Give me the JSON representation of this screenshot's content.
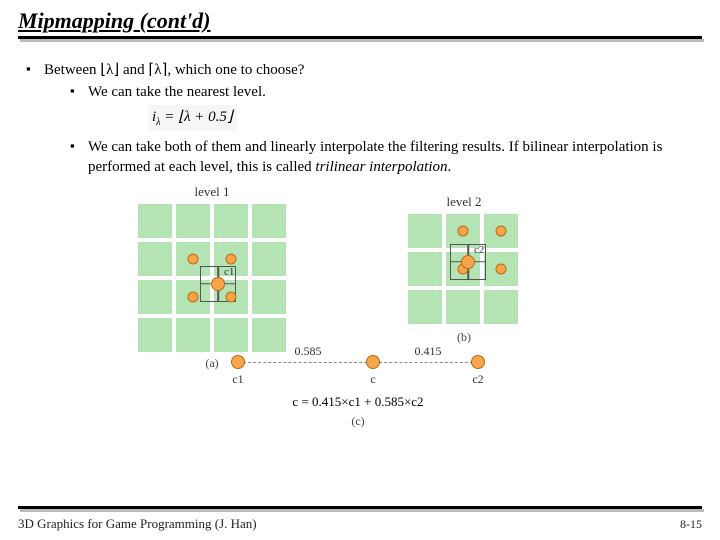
{
  "slide": {
    "title": "Mipmapping (cont'd)",
    "bullet_main": "Between ⌊λ⌋ and ⌈λ⌉, which one to choose?",
    "sub1": "We can take the nearest level.",
    "formula_nearest": "iλ = ⌊λ + 0.5⌋",
    "sub2_prefix": "We can take both of them and linearly interpolate the filtering results. If bilinear interpolation is performed at each level, this is called ",
    "sub2_em": "trilinear interpolation",
    "sub2_suffix": "."
  },
  "figure": {
    "level1_label": "level 1",
    "level2_label": "level 2",
    "c1_label": "c1",
    "c2_label": "c2",
    "caption_a": "(a)",
    "caption_b": "(b)",
    "caption_c": "(c)",
    "w1": "0.585",
    "w2": "0.415",
    "pt_left": "c1",
    "pt_mid": "c",
    "pt_right": "c2",
    "interp_formula": "c = 0.415×c1 + 0.585×c2"
  },
  "footer": {
    "text": "3D Graphics for Game Programming (J. Han)",
    "page": "8-15"
  }
}
